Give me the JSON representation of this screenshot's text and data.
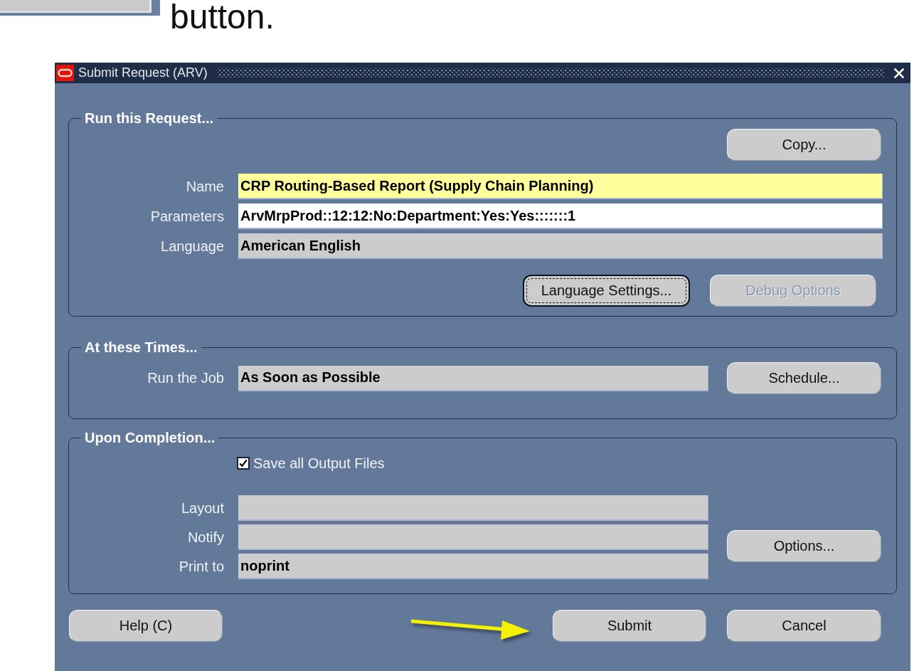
{
  "slide_fragment": {
    "caption": "button."
  },
  "window": {
    "title": "Submit Request (ARV)"
  },
  "run_this_request": {
    "title": "Run this Request...",
    "copy_button": {
      "label": "Copy..."
    },
    "fields": [
      {
        "label": "Name",
        "value": "CRP Routing-Based Report (Supply Chain Planning)",
        "kind": "required"
      },
      {
        "label": "Parameters",
        "value": "ArvMrpProd::12:12:No:Department:Yes:Yes:::::::1",
        "kind": "editable"
      },
      {
        "label": "Language",
        "value": "American English",
        "kind": "readonly"
      }
    ],
    "language_settings_button": {
      "label": "Language Settings...",
      "focused": true,
      "disabled": false
    },
    "debug_options_button": {
      "label": "Debug Options",
      "focused": false,
      "disabled": true
    }
  },
  "at_these_times": {
    "title": "At these Times...",
    "fields": [
      {
        "label": "Run the Job",
        "value": "As Soon as Possible",
        "kind": "readonly"
      }
    ],
    "schedule_button": {
      "label": "Schedule..."
    }
  },
  "upon_completion": {
    "title": "Upon Completion...",
    "save_output": {
      "label": "Save all Output Files",
      "checked": true
    },
    "fields": [
      {
        "label": "Layout",
        "kind": "readonly"
      },
      {
        "label": "Notify",
        "kind": "readonly"
      },
      {
        "label": "Print to",
        "value": "noprint",
        "kind": "readonly"
      }
    ],
    "options_button": {
      "label": "Options..."
    }
  },
  "help_button": {
    "label": "Help (C)"
  },
  "submit_button": {
    "label": "Submit"
  },
  "cancel_button": {
    "label": "Cancel"
  }
}
